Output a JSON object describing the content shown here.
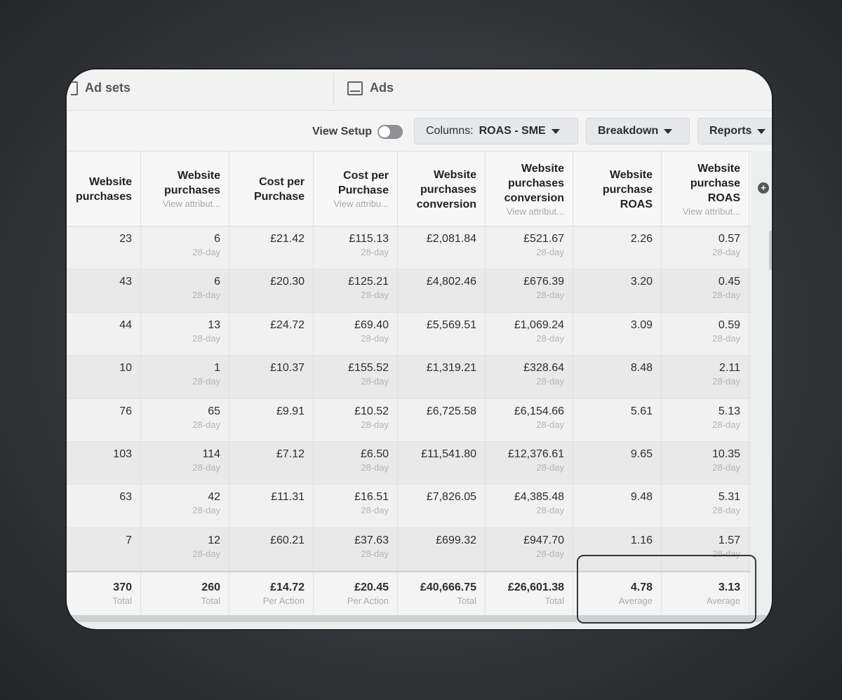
{
  "tabs": [
    {
      "label": "Ad sets",
      "icon": "adsets-icon"
    },
    {
      "label": "Ads",
      "icon": "ads-icon"
    }
  ],
  "toolbar": {
    "view_setup_label": "View Setup",
    "view_setup_on": false,
    "columns_prefix": "Columns:",
    "columns_value": "ROAS - SME",
    "breakdown_label": "Breakdown",
    "reports_label": "Reports"
  },
  "table": {
    "headers": [
      {
        "line1": "Website",
        "line2": "purchases",
        "line3": "",
        "sub": ""
      },
      {
        "line1": "Website",
        "line2": "purchases",
        "line3": "",
        "sub": "View attribut..."
      },
      {
        "line1": "Cost per",
        "line2": "Purchase",
        "line3": "",
        "sub": ""
      },
      {
        "line1": "Cost per",
        "line2": "Purchase",
        "line3": "",
        "sub": "View attribu..."
      },
      {
        "line1": "Website",
        "line2": "purchases",
        "line3": "conversion",
        "sub": ""
      },
      {
        "line1": "Website",
        "line2": "purchases",
        "line3": "conversion",
        "sub": "View attribut..."
      },
      {
        "line1": "Website",
        "line2": "purchase",
        "line3": "ROAS",
        "sub": ""
      },
      {
        "line1": "Website",
        "line2": "purchase",
        "line3": "ROAS",
        "sub": "View attribut..."
      }
    ],
    "rows": [
      {
        "c": [
          "23",
          "6",
          "£21.42",
          "£115.13",
          "£2,081.84",
          "£521.67",
          "2.26",
          "0.57"
        ],
        "s": [
          "",
          "28-day",
          "",
          "28-day",
          "",
          "28-day",
          "",
          "28-day"
        ]
      },
      {
        "c": [
          "43",
          "6",
          "£20.30",
          "£125.21",
          "£4,802.46",
          "£676.39",
          "3.20",
          "0.45"
        ],
        "s": [
          "",
          "28-day",
          "",
          "28-day",
          "",
          "28-day",
          "",
          "28-day"
        ]
      },
      {
        "c": [
          "44",
          "13",
          "£24.72",
          "£69.40",
          "£5,569.51",
          "£1,069.24",
          "3.09",
          "0.59"
        ],
        "s": [
          "",
          "28-day",
          "",
          "28-day",
          "",
          "28-day",
          "",
          "28-day"
        ]
      },
      {
        "c": [
          "10",
          "1",
          "£10.37",
          "£155.52",
          "£1,319.21",
          "£328.64",
          "8.48",
          "2.11"
        ],
        "s": [
          "",
          "28-day",
          "",
          "28-day",
          "",
          "28-day",
          "",
          "28-day"
        ]
      },
      {
        "c": [
          "76",
          "65",
          "£9.91",
          "£10.52",
          "£6,725.58",
          "£6,154.66",
          "5.61",
          "5.13"
        ],
        "s": [
          "",
          "28-day",
          "",
          "28-day",
          "",
          "28-day",
          "",
          "28-day"
        ]
      },
      {
        "c": [
          "103",
          "114",
          "£7.12",
          "£6.50",
          "£11,541.80",
          "£12,376.61",
          "9.65",
          "10.35"
        ],
        "s": [
          "",
          "28-day",
          "",
          "28-day",
          "",
          "28-day",
          "",
          "28-day"
        ]
      },
      {
        "c": [
          "63",
          "42",
          "£11.31",
          "£16.51",
          "£7,826.05",
          "£4,385.48",
          "9.48",
          "5.31"
        ],
        "s": [
          "",
          "28-day",
          "",
          "28-day",
          "",
          "28-day",
          "",
          "28-day"
        ]
      },
      {
        "c": [
          "7",
          "12",
          "£60.21",
          "£37.63",
          "£699.32",
          "£947.70",
          "1.16",
          "1.57"
        ],
        "s": [
          "",
          "28-day",
          "",
          "28-day",
          "",
          "28-day",
          "",
          "28-day"
        ]
      }
    ],
    "totals": {
      "c": [
        "370",
        "260",
        "£14.72",
        "£20.45",
        "£40,666.75",
        "£26,601.38",
        "4.78",
        "3.13"
      ],
      "s": [
        "Total",
        "Total",
        "Per Action",
        "Per Action",
        "Total",
        "Total",
        "Average",
        "Average"
      ]
    }
  },
  "colors": {
    "frame_bg": "#eceded",
    "highlight_border": "#34363a"
  }
}
